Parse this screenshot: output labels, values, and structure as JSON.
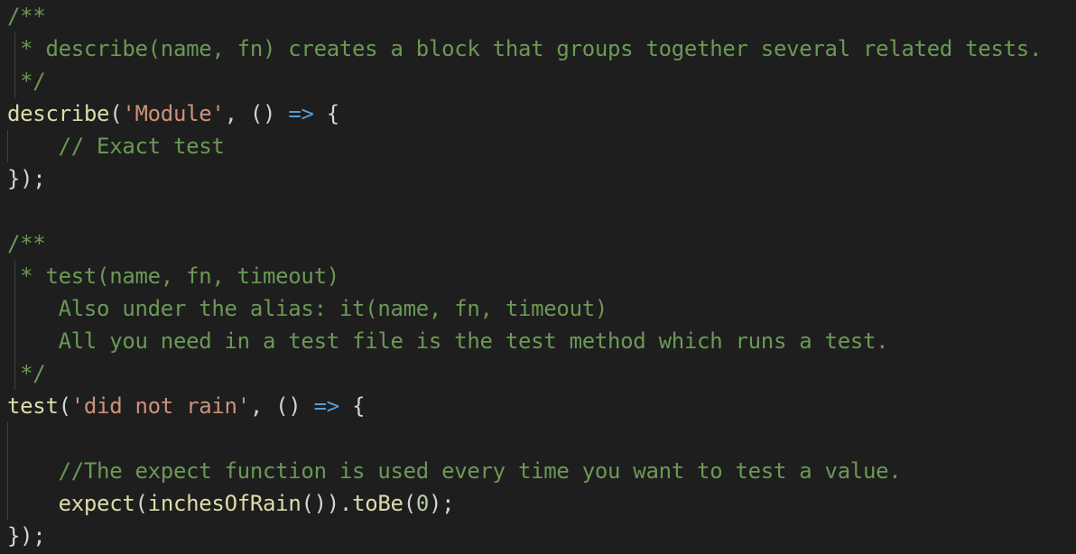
{
  "colors": {
    "background": "#1e1e1e",
    "comment": "#6a9955",
    "function": "#dcdcaa",
    "string": "#ce9178",
    "keyword": "#569cd6",
    "number": "#b5cea8",
    "punctuation": "#d4d4d4",
    "indent_guide": "#404040"
  },
  "code": {
    "l1": "/**",
    "l2": " * describe(name, fn) creates a block that groups together several related tests.",
    "l3": " */",
    "l4": {
      "fn": "describe",
      "open": "(",
      "str": "'Module'",
      "mid": ", () ",
      "arrow": "=>",
      "end": " {"
    },
    "l5": "    // Exact test",
    "l6": "});",
    "l8": "/**",
    "l9": " * test(name, fn, timeout)",
    "l10": "    Also under the alias: it(name, fn, timeout)",
    "l11": "    All you need in a test file is the test method which runs a test.",
    "l12": " */",
    "l13": {
      "fn": "test",
      "open": "(",
      "str": "'did not rain'",
      "mid": ", () ",
      "arrow": "=>",
      "end": " {"
    },
    "l15": "    //The expect function is used every time you want to test a value.",
    "l16": {
      "indent": "    ",
      "fn1": "expect",
      "p1": "(",
      "fn2": "inchesOfRain",
      "p2": "()).",
      "fn3": "toBe",
      "p3": "(",
      "num": "0",
      "p4": ");"
    },
    "l17": "});"
  }
}
